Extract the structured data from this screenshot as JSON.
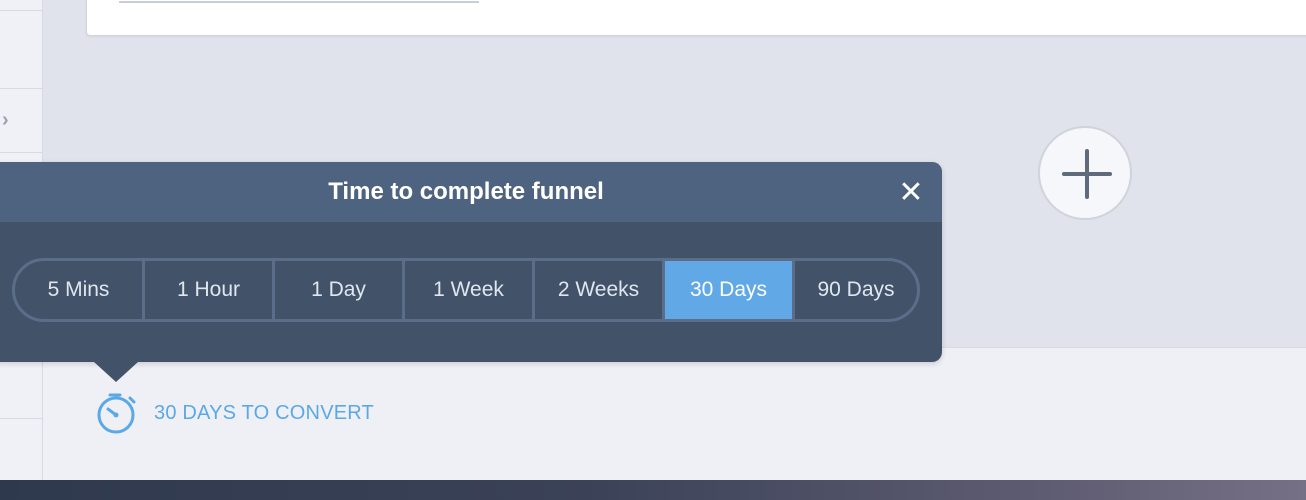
{
  "popover": {
    "title": "Time to complete funnel",
    "close_glyph": "✕",
    "options": [
      {
        "label": "5 Mins",
        "selected": false
      },
      {
        "label": "1 Hour",
        "selected": false
      },
      {
        "label": "1 Day",
        "selected": false
      },
      {
        "label": "1 Week",
        "selected": false
      },
      {
        "label": "2 Weeks",
        "selected": false
      },
      {
        "label": "30 Days",
        "selected": true
      },
      {
        "label": "90 Days",
        "selected": false
      }
    ]
  },
  "footer": {
    "convert_label": "30 DAYS TO CONVERT",
    "icon": "stopwatch-icon"
  },
  "add_step": {
    "icon": "plus-icon"
  },
  "sidebar": {
    "chevron": "›"
  },
  "colors": {
    "accent": "#61a9e6",
    "popover_bg": "#425269",
    "popover_header": "#4e6380",
    "link": "#5aa9e6"
  }
}
